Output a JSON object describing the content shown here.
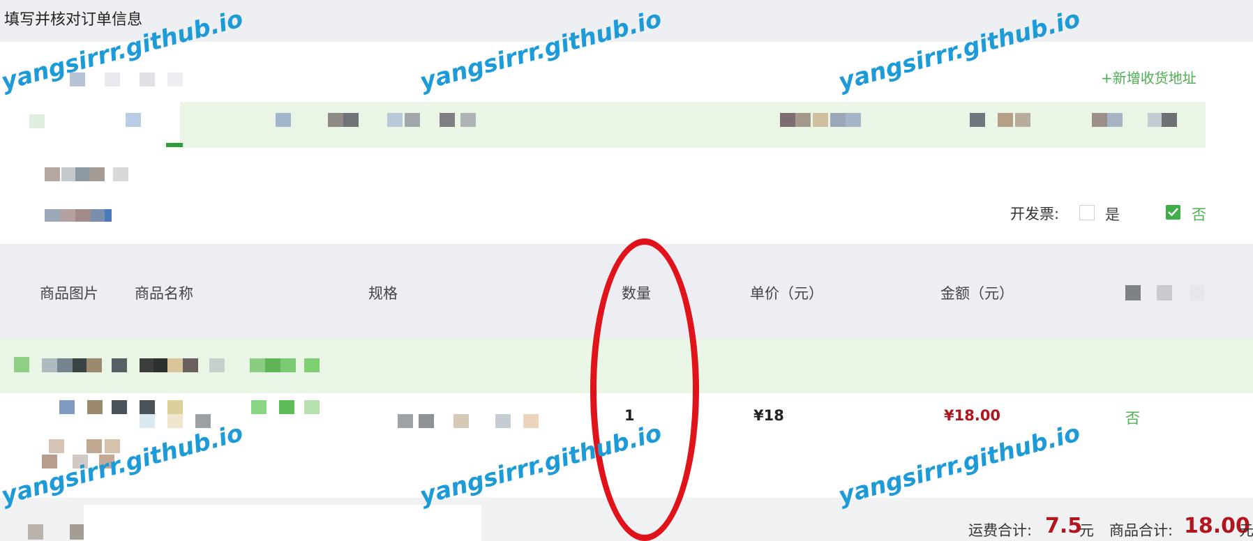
{
  "header": {
    "title": "填写并核对订单信息"
  },
  "address": {
    "add_label": "+新增收货地址"
  },
  "invoice": {
    "label": "开发票:",
    "yes": "是",
    "no": "否",
    "selected": "否"
  },
  "table": {
    "columns": [
      "商品图片",
      "商品名称",
      "规格",
      "数量",
      "单价（元）",
      "金额（元）"
    ],
    "row": {
      "quantity": "1",
      "unit_price": "¥18",
      "amount": "¥18.00",
      "flag": "否"
    }
  },
  "footer": {
    "shipping_label": "运费合计:",
    "shipping_value": "7.5",
    "shipping_unit": "元",
    "goods_label": "商品合计:",
    "goods_value": "18.00",
    "goods_unit": "元"
  },
  "watermark": {
    "text": "yangsirrr.github.io"
  },
  "colors": {
    "accent": "#3fae49",
    "price": "#b0161d",
    "annotation": "#e0121a",
    "watermark": "#1d9bd8"
  }
}
